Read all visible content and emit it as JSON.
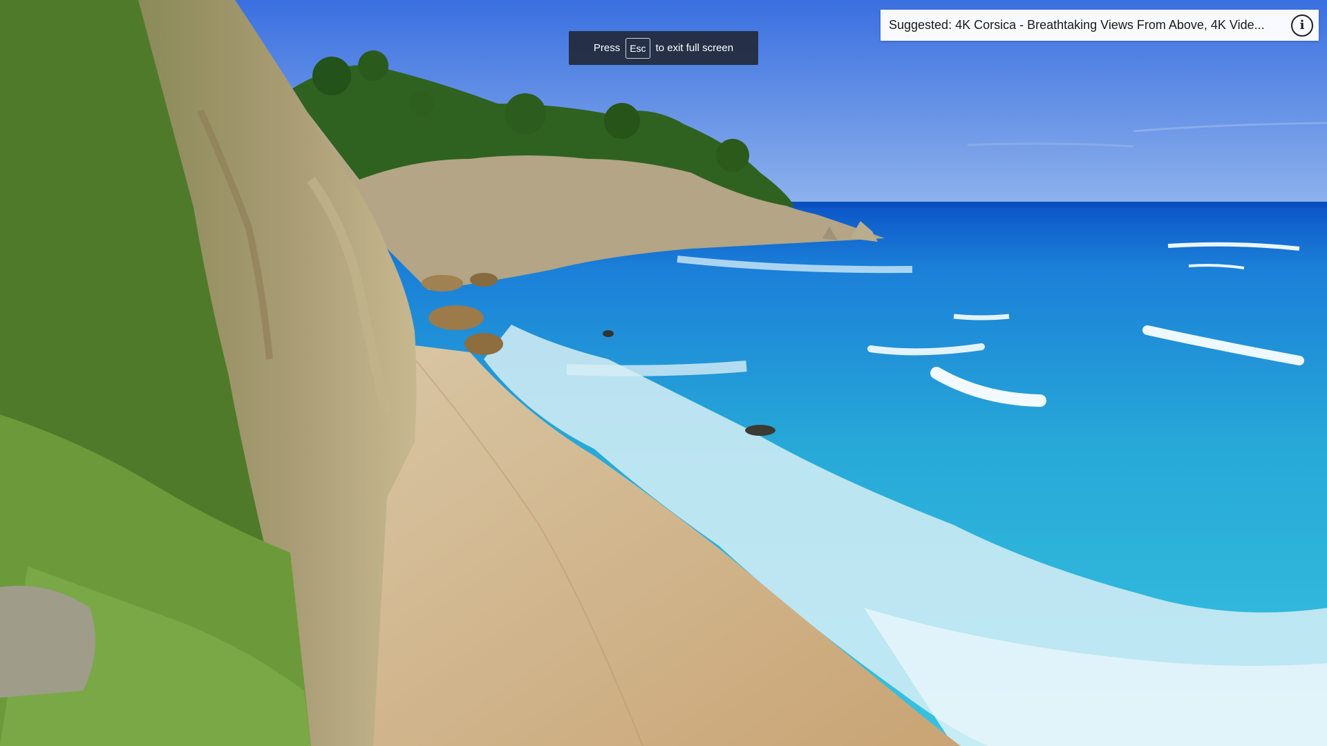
{
  "fullscreen_hint": {
    "press_label": "Press",
    "key_label": "Esc",
    "action_label": "to exit full screen"
  },
  "suggestion": {
    "text": "Suggested: 4K Corsica - Breathtaking Views From Above, 4K Vide...",
    "info_glyph": "i",
    "info_icon": "info-icon"
  },
  "colors": {
    "sky_top": "#3f78e6",
    "sea_deep": "#0a5bd0",
    "sea_turquoise": "#2fb8dc",
    "sand": "#d9b98a",
    "cliff": "#a79a72",
    "vegetation": "#3f6b22",
    "hint_bg": "#202632"
  }
}
